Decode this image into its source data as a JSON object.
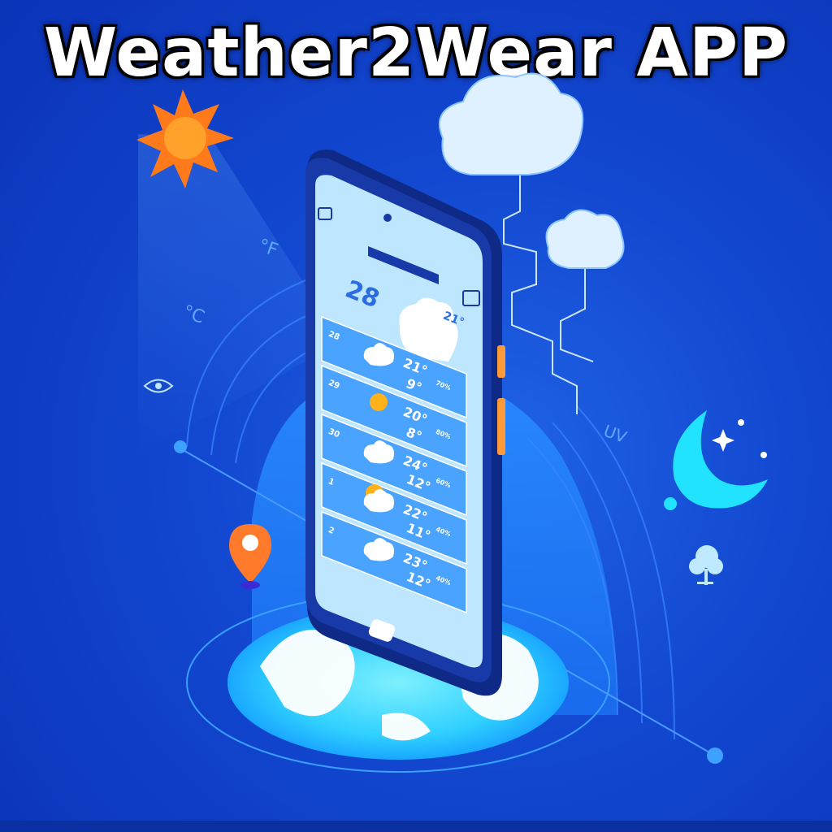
{
  "title": "Weather2Wear APP",
  "labels": {
    "fahrenheit": "°F",
    "celsius": "°C",
    "uv": "UV"
  },
  "phone_screen": {
    "current_temp": "28",
    "secondary_temp": "21°",
    "forecast": [
      {
        "day": "28",
        "icon": "cloud-icon",
        "high": "21°",
        "low": "9°",
        "extra": "70%"
      },
      {
        "day": "29",
        "icon": "sun-icon",
        "high": "20°",
        "low": "8°",
        "extra": "80%"
      },
      {
        "day": "30",
        "icon": "cloud-icon",
        "high": "24°",
        "low": "12°",
        "extra": "60%"
      },
      {
        "day": "1",
        "icon": "partly-cloudy-icon",
        "high": "22°",
        "low": "11°",
        "extra": "40%"
      },
      {
        "day": "2",
        "icon": "cloud-icon",
        "high": "23°",
        "low": "12°",
        "extra": "40%"
      }
    ]
  },
  "colors": {
    "background": "#1247d0",
    "sun": "#ff7a1a",
    "moon": "#22e3ff",
    "screen": "#bfe6ff",
    "row": "#5ab0ff",
    "pin": "#ff7a2a"
  }
}
